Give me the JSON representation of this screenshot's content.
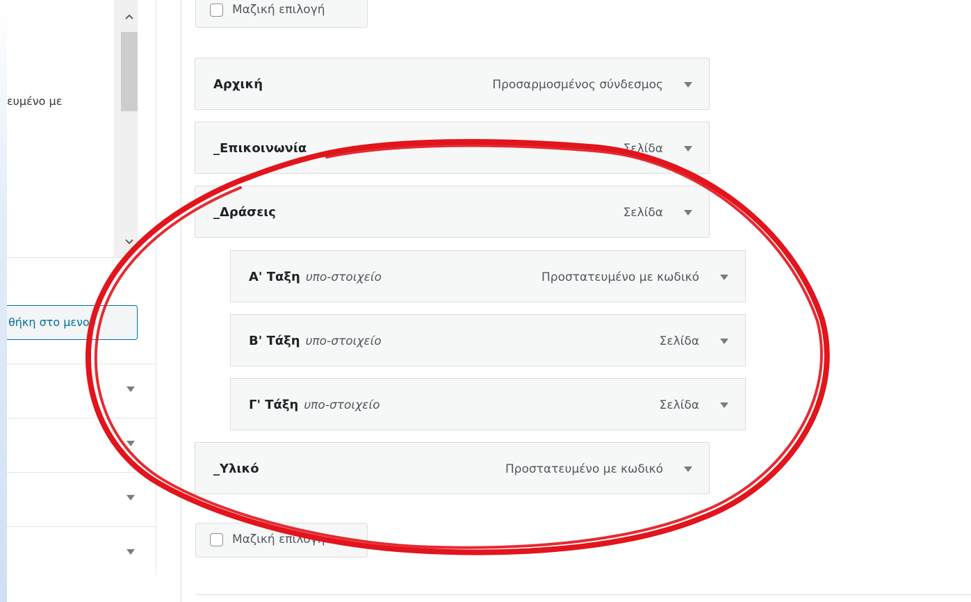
{
  "left_panel": {
    "list_partial_text": "ευμένο με",
    "add_to_menu_button": "θήκη στο μενού",
    "scroll_up_icon": "chevron-up",
    "scroll_down_icon": "chevron-down"
  },
  "bulk_select": {
    "top_label": "Μαζική επιλογή",
    "bottom_label": "Μαζική επιλογή"
  },
  "menu_items": [
    {
      "title": "Αρχική",
      "sub": "",
      "type": "Προσαρμοσμένος σύνδεσμος"
    },
    {
      "title": "_Επικοινωνία",
      "sub": "",
      "type": "Σελίδα"
    },
    {
      "title": "_Δράσεις",
      "sub": "",
      "type": "Σελίδα"
    },
    {
      "title": "Α' Ταξη",
      "sub": "υπο-στοιχείο",
      "type": "Προστατευμένο με κωδικό"
    },
    {
      "title": "Β' Τάξη",
      "sub": "υπο-στοιχείο",
      "type": "Σελίδα"
    },
    {
      "title": "Γ' Τάξη",
      "sub": "υπο-στοιχείο",
      "type": "Σελίδα"
    },
    {
      "title": "_Υλικό",
      "sub": "",
      "type": "Προστατευμένο με κωδικό"
    }
  ],
  "colors": {
    "annotation_red": "#e2141c",
    "link_blue": "#0071a1"
  }
}
